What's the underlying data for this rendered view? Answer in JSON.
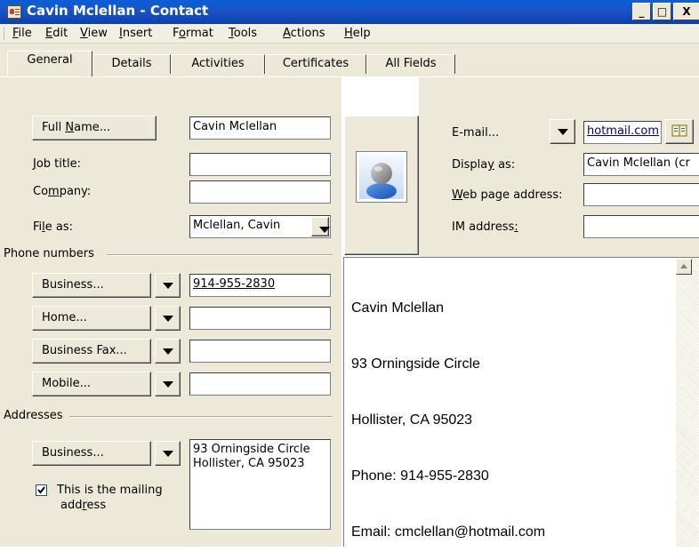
{
  "window": {
    "title": "Cavin Mclellan - Contact",
    "minimize": "_",
    "maximize": "□",
    "close": "X"
  },
  "menu": [
    {
      "pre": "",
      "key": "F",
      "post": "ile"
    },
    {
      "pre": "",
      "key": "E",
      "post": "dit"
    },
    {
      "pre": "",
      "key": "V",
      "post": "iew"
    },
    {
      "pre": "",
      "key": "I",
      "post": "nsert"
    },
    {
      "pre": "F",
      "key": "o",
      "post": "rmat"
    },
    {
      "pre": "",
      "key": "T",
      "post": "ools"
    },
    {
      "pre": "",
      "key": "A",
      "post": "ctions"
    },
    {
      "pre": "",
      "key": "H",
      "post": "elp"
    }
  ],
  "tabs": [
    "General",
    "Details",
    "Activities",
    "Certificates",
    "All Fields"
  ],
  "name_section": {
    "full_name_button": {
      "pre": "Full ",
      "key": "N",
      "post": "ame..."
    },
    "full_name_value": "Cavin Mclellan",
    "job_title_label": {
      "pre": "",
      "key": "J",
      "post": "ob title:"
    },
    "job_title_value": "",
    "company_label": {
      "pre": "Co",
      "key": "m",
      "post": "pany:"
    },
    "company_value": "",
    "file_as_label": {
      "pre": "Fi",
      "key": "l",
      "post": "e as:"
    },
    "file_as_value": "Mclellan, Cavin"
  },
  "phone_section": {
    "title": "Phone numbers",
    "rows": [
      {
        "label": "Business...",
        "value": "914-955-2830"
      },
      {
        "label": "Home...",
        "value": ""
      },
      {
        "label": "Business Fax...",
        "value": ""
      },
      {
        "label": "Mobile...",
        "value": ""
      }
    ]
  },
  "address_section": {
    "title": "Addresses",
    "type_label": "Business...",
    "address_line1": "93 Orningside Circle",
    "address_line2": "Hollister, CA 95023",
    "mailing_line1": "This is the mailing",
    "mailing_line2_pre": "add",
    "mailing_line2_key": "r",
    "mailing_line2_post": "ess",
    "mailing_checked": true
  },
  "internet_section": {
    "email_label": "E-mail...",
    "email_value": "hotmail.com",
    "display_as_label": {
      "pre": "Displa",
      "key": "y",
      "post": " as:"
    },
    "display_as_value": "Cavin Mclellan (cr",
    "web_label": {
      "pre": "",
      "key": "W",
      "post": "eb page address:"
    },
    "web_value": "",
    "im_label": {
      "pre": "IM address",
      "key": ":",
      "post": ""
    },
    "im_value": ""
  },
  "notes": {
    "line1": "Cavin Mclellan",
    "line2": "93 Orningside Circle",
    "line3": "Hollister, CA 95023",
    "line4": "Phone: 914-955-2830",
    "line5": "Email: cmclellan@hotmail.com"
  },
  "colors": {
    "titlebar": "#0b4fd0",
    "face": "#ece9d8",
    "link": "#000080"
  },
  "icons": {
    "title": "contact-card-icon",
    "photo": "contact-photo-icon",
    "address_book": "address-book-icon"
  }
}
